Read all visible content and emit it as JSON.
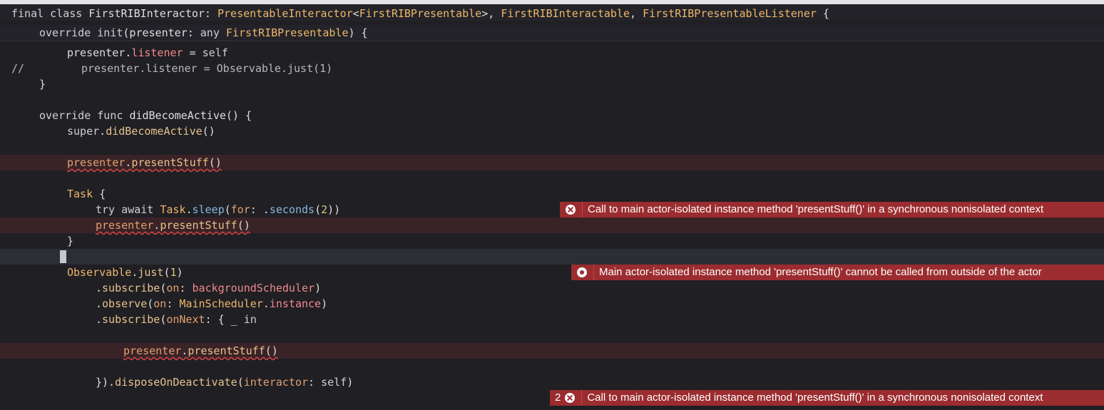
{
  "editor": {
    "lines": [
      {
        "id": "l1",
        "tokens": [
          [
            "kw",
            "final class "
          ],
          [
            "pl",
            "FirstRIBInteractor: "
          ],
          [
            "ty",
            "PresentableInteractor"
          ],
          [
            "pl",
            "<"
          ],
          [
            "ty",
            "FirstRIBPresentable"
          ],
          [
            "pl",
            ">, "
          ],
          [
            "ty",
            "FirstRIBInteractable"
          ],
          [
            "pl",
            ", "
          ],
          [
            "ty",
            "FirstRIBPresentableListener"
          ],
          [
            "pl",
            " {"
          ]
        ]
      },
      {
        "id": "l2",
        "tokens": [
          [
            "kw",
            "override init"
          ],
          [
            "pl",
            "(presenter: "
          ],
          [
            "kw",
            "any "
          ],
          [
            "ty",
            "FirstRIBPresentable"
          ],
          [
            "pl",
            ") {"
          ]
        ]
      },
      {
        "id": "l3",
        "tokens": [
          [
            "pl",
            "presenter."
          ],
          [
            "prop",
            "listener"
          ],
          [
            "pl",
            " = "
          ],
          [
            "kw",
            "self"
          ]
        ]
      },
      {
        "id": "l4a",
        "tokens": [
          [
            "cm",
            "//"
          ]
        ]
      },
      {
        "id": "l4b",
        "tokens": [
          [
            "cm",
            "presenter.listener = Observable.just(1)"
          ]
        ]
      },
      {
        "id": "l5",
        "tokens": [
          [
            "pl",
            "}"
          ]
        ]
      },
      {
        "id": "l7",
        "tokens": [
          [
            "kw",
            "override func "
          ],
          [
            "pl",
            "didBecomeActive() {"
          ]
        ]
      },
      {
        "id": "l8",
        "tokens": [
          [
            "kw",
            "super"
          ],
          [
            "pl",
            "."
          ],
          [
            "fn",
            "didBecomeActive"
          ],
          [
            "pl",
            "()"
          ]
        ]
      },
      {
        "id": "l10",
        "tokens": [
          [
            "mem",
            "presenter"
          ],
          [
            "pl",
            "."
          ],
          [
            "fn",
            "presentStuff"
          ],
          [
            "pl",
            "()"
          ]
        ]
      },
      {
        "id": "l12",
        "tokens": [
          [
            "ty",
            "Task"
          ],
          [
            "pl",
            " {"
          ]
        ]
      },
      {
        "id": "l13",
        "tokens": [
          [
            "kw",
            "try await "
          ],
          [
            "ty",
            "Task"
          ],
          [
            "pl",
            "."
          ],
          [
            "enum",
            "sleep"
          ],
          [
            "pl",
            "("
          ],
          [
            "param",
            "for"
          ],
          [
            "pl",
            ": ."
          ],
          [
            "enum",
            "seconds"
          ],
          [
            "pl",
            "("
          ],
          [
            "num",
            "2"
          ],
          [
            "pl",
            "))"
          ]
        ]
      },
      {
        "id": "l14",
        "tokens": [
          [
            "mem",
            "presenter"
          ],
          [
            "pl",
            "."
          ],
          [
            "fn",
            "presentStuff"
          ],
          [
            "pl",
            "()"
          ]
        ]
      },
      {
        "id": "l15",
        "tokens": [
          [
            "pl",
            "}"
          ]
        ]
      },
      {
        "id": "l17",
        "tokens": [
          [
            "ty",
            "Observable"
          ],
          [
            "pl",
            "."
          ],
          [
            "fn",
            "just"
          ],
          [
            "pl",
            "("
          ],
          [
            "num",
            "1"
          ],
          [
            "pl",
            ")"
          ]
        ]
      },
      {
        "id": "l18",
        "tokens": [
          [
            "pl",
            "."
          ],
          [
            "fn",
            "subscribe"
          ],
          [
            "pl",
            "("
          ],
          [
            "param",
            "on"
          ],
          [
            "pl",
            ": "
          ],
          [
            "prop",
            "backgroundScheduler"
          ],
          [
            "pl",
            ")"
          ]
        ]
      },
      {
        "id": "l19",
        "tokens": [
          [
            "pl",
            "."
          ],
          [
            "fn",
            "observe"
          ],
          [
            "pl",
            "("
          ],
          [
            "param",
            "on"
          ],
          [
            "pl",
            ": "
          ],
          [
            "ty",
            "MainScheduler"
          ],
          [
            "pl",
            "."
          ],
          [
            "prop",
            "instance"
          ],
          [
            "pl",
            ")"
          ]
        ]
      },
      {
        "id": "l20",
        "tokens": [
          [
            "pl",
            "."
          ],
          [
            "fn",
            "subscribe"
          ],
          [
            "pl",
            "("
          ],
          [
            "param",
            "onNext"
          ],
          [
            "pl",
            ": { _ "
          ],
          [
            "kw",
            "in"
          ]
        ]
      },
      {
        "id": "l22",
        "tokens": [
          [
            "mem",
            "presenter"
          ],
          [
            "pl",
            "."
          ],
          [
            "fn",
            "presentStuff"
          ],
          [
            "pl",
            "()"
          ]
        ]
      },
      {
        "id": "l24",
        "tokens": [
          [
            "pl",
            "})."
          ],
          [
            "fn",
            "disposeOnDeactivate"
          ],
          [
            "pl",
            "("
          ],
          [
            "param",
            "interactor"
          ],
          [
            "pl",
            ": "
          ],
          [
            "kw",
            "self"
          ],
          [
            "pl",
            ")"
          ]
        ]
      }
    ]
  },
  "errors": {
    "e1": {
      "count": "",
      "icon": "error-x",
      "message": "Call to main actor-isolated instance method 'presentStuff()' in a synchronous nonisolated context"
    },
    "e2": {
      "count": "",
      "icon": "error-dot",
      "message": "Main actor-isolated instance method 'presentStuff()' cannot be called from outside of the actor"
    },
    "e3": {
      "count": "2",
      "icon": "error-x",
      "message": "Call to main actor-isolated instance method 'presentStuff()' in a synchronous nonisolated context"
    }
  },
  "colors": {
    "background": "#1f1f24",
    "error_line": "#3a2327",
    "error_badge": "#9b2c2f",
    "current_line": "#2c2e36"
  }
}
